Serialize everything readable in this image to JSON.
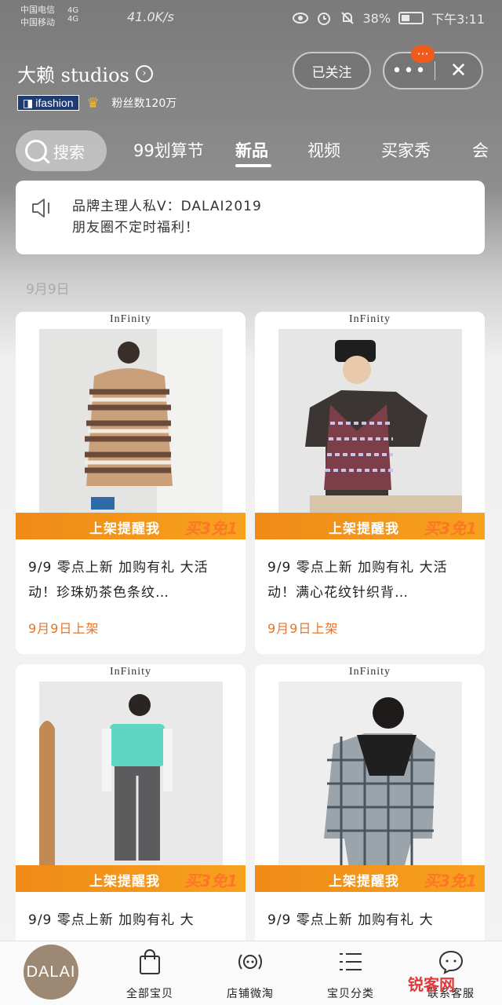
{
  "status_bar": {
    "carrier1": "中国电信",
    "carrier2": "中国移动",
    "net1": "4G",
    "net2": "4G",
    "speed": "41.0K/s",
    "battery": "38%",
    "time": "下午3:11"
  },
  "header": {
    "shop_name": "大赖 studios",
    "ifashion": "ifashion",
    "fans": "粉丝数120万",
    "follow_label": "已关注",
    "more_badge": "···"
  },
  "tabs": {
    "search": "搜索",
    "items": [
      "99划算节",
      "新品",
      "视频",
      "买家秀",
      "会"
    ]
  },
  "notice": {
    "line1": "品牌主理人私V：DALAI2019",
    "line2": "朋友圈不定时福利！"
  },
  "section_date": "9月9日",
  "products": [
    {
      "brand": "InFinity",
      "banner": "上架提醒我",
      "promo": "买3免1",
      "title": "9/9 零点上新 加购有礼 大活动！珍珠奶茶色条纹…",
      "date": "9月9日上架"
    },
    {
      "brand": "InFinity",
      "banner": "上架提醒我",
      "promo": "买3免1",
      "title": "9/9 零点上新 加购有礼 大活动！满心花纹针织背…",
      "date": "9月9日上架"
    },
    {
      "brand": "InFinity",
      "banner": "上架提醒我",
      "promo": "买3免1",
      "title": "9/9 零点上新 加购有礼 大"
    },
    {
      "brand": "InFinity",
      "banner": "上架提醒我",
      "promo": "买3免1",
      "title": "9/9 零点上新 加购有礼 大"
    }
  ],
  "bottom_nav": {
    "logo": "DALAI",
    "items": [
      "全部宝贝",
      "店铺微淘",
      "宝贝分类",
      "联系客服"
    ]
  },
  "watermark": "锐客网"
}
